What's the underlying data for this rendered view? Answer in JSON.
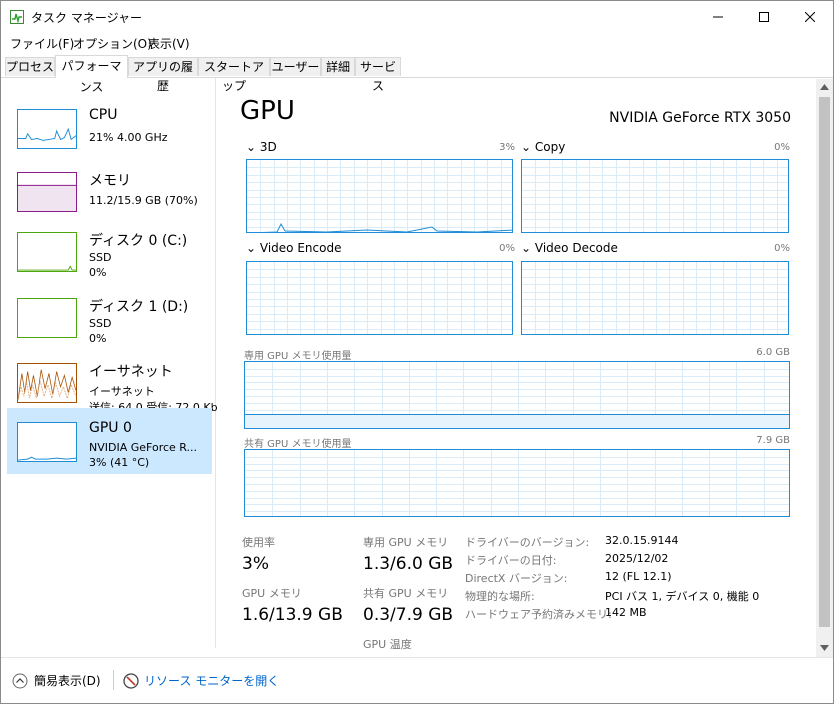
{
  "window": {
    "title": "タスク マネージャー"
  },
  "menu": [
    "ファイル(F)",
    "オプション(O)",
    "表示(V)"
  ],
  "tabs": [
    "プロセス",
    "パフォーマンス",
    "アプリの履歴",
    "スタートアップ",
    "ユーザー",
    "詳細",
    "サービス"
  ],
  "resources": [
    {
      "name": "CPU",
      "line1": "21%  4.00 GHz",
      "line2": "",
      "color": "#1f8dd6"
    },
    {
      "name": "メモリ",
      "line1": "11.2/15.9 GB (70%)",
      "line2": "",
      "color": "#8b1a8b"
    },
    {
      "name": "ディスク 0 (C:)",
      "line1": "SSD",
      "line2": "0%",
      "color": "#4da60c"
    },
    {
      "name": "ディスク 1 (D:)",
      "line1": "SSD",
      "line2": "0%",
      "color": "#4da60c"
    },
    {
      "name": "イーサネット",
      "line1": "イーサネット",
      "line2": "送信: 64.0  受信: 72.0 Kb",
      "color": "#a74f01"
    },
    {
      "name": "GPU 0",
      "line1": "NVIDIA GeForce R...",
      "line2": "3% (41 °C)",
      "color": "#1f8dd6"
    }
  ],
  "gpu": {
    "title": "GPU",
    "model": "NVIDIA GeForce RTX 3050",
    "engines": [
      {
        "name": "3D",
        "pct": "3%"
      },
      {
        "name": "Copy",
        "pct": "0%"
      },
      {
        "name": "Video Encode",
        "pct": "0%"
      },
      {
        "name": "Video Decode",
        "pct": "0%"
      }
    ],
    "dedicated": {
      "label": "専用 GPU メモリ使用量",
      "max": "6.0 GB"
    },
    "shared": {
      "label": "共有 GPU メモリ使用量",
      "max": "7.9 GB"
    },
    "stats": {
      "util_label": "使用率",
      "util_value": "3%",
      "gpumem_label": "GPU メモリ",
      "gpumem_value": "1.6/13.9 GB",
      "ded_label": "専用 GPU メモリ",
      "ded_value": "1.3/6.0 GB",
      "shared_label": "共有 GPU メモリ",
      "shared_value": "0.3/7.9 GB",
      "temp_label": "GPU 温度"
    },
    "details": [
      {
        "label": "ドライバーのバージョン:",
        "value": "32.0.15.9144"
      },
      {
        "label": "ドライバーの日付:",
        "value": "2025/12/02"
      },
      {
        "label": "DirectX バージョン:",
        "value": "12 (FL 12.1)"
      },
      {
        "label": "物理的な場所:",
        "value": "PCI バス 1, デバイス 0, 機能 0"
      },
      {
        "label": "ハードウェア予約済みメモリ:",
        "value": "142 MB"
      }
    ]
  },
  "bottom": {
    "fewer": "簡易表示(D)",
    "monitor": "リソース モニターを開く"
  }
}
